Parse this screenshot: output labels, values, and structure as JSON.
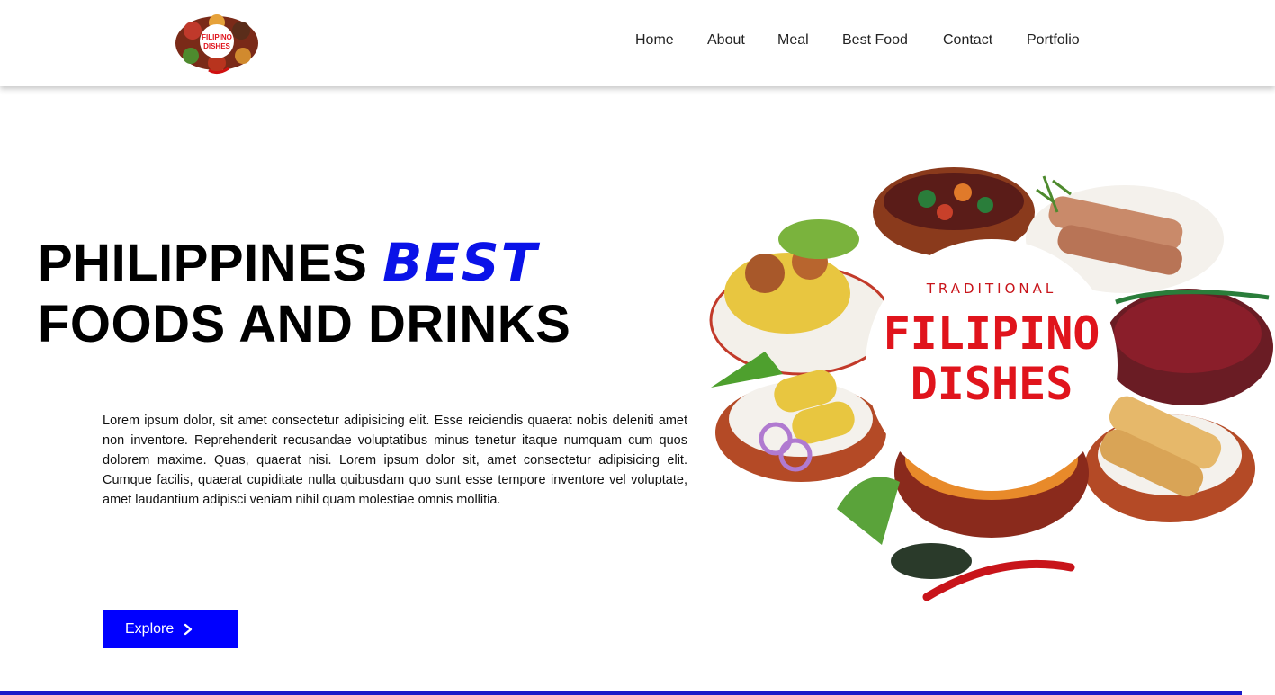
{
  "logo": {
    "line1": "FILIPINO",
    "line2": "DISHES"
  },
  "nav": {
    "items": [
      {
        "label": "Home"
      },
      {
        "label": "About"
      },
      {
        "label": "Meal"
      },
      {
        "label": "Best Food"
      },
      {
        "label": "Contact"
      },
      {
        "label": "Portfolio"
      }
    ]
  },
  "hero": {
    "title_part1": "PHILIPPINES ",
    "title_accent": "BEST",
    "title_part2": "FOODS AND DRINKS",
    "text": "Lorem ipsum dolor, sit amet consectetur adipisicing elit. Esse reiciendis quaerat nobis deleniti amet non inventore. Reprehenderit recusandae voluptatibus minus tenetur itaque numquam cum quos dolorem maxime. Quas, quaerat nisi. Lorem ipsum dolor sit, amet consectetur adipisicing elit. Cumque facilis, quaerat cupiditate nulla quibusdam quo sunt esse tempore inventore vel voluptate, amet laudantium adipisci veniam nihil quam molestiae omnis mollitia.",
    "button_label": "Explore",
    "button_icon": "chevron-right-icon"
  },
  "illustration": {
    "small_text": "TRADITIONAL",
    "line1": "FILIPINO",
    "line2": "DISHES"
  },
  "colors": {
    "accent": "#0a12e8",
    "button": "#0000ff",
    "logo_red": "#e0141c"
  }
}
